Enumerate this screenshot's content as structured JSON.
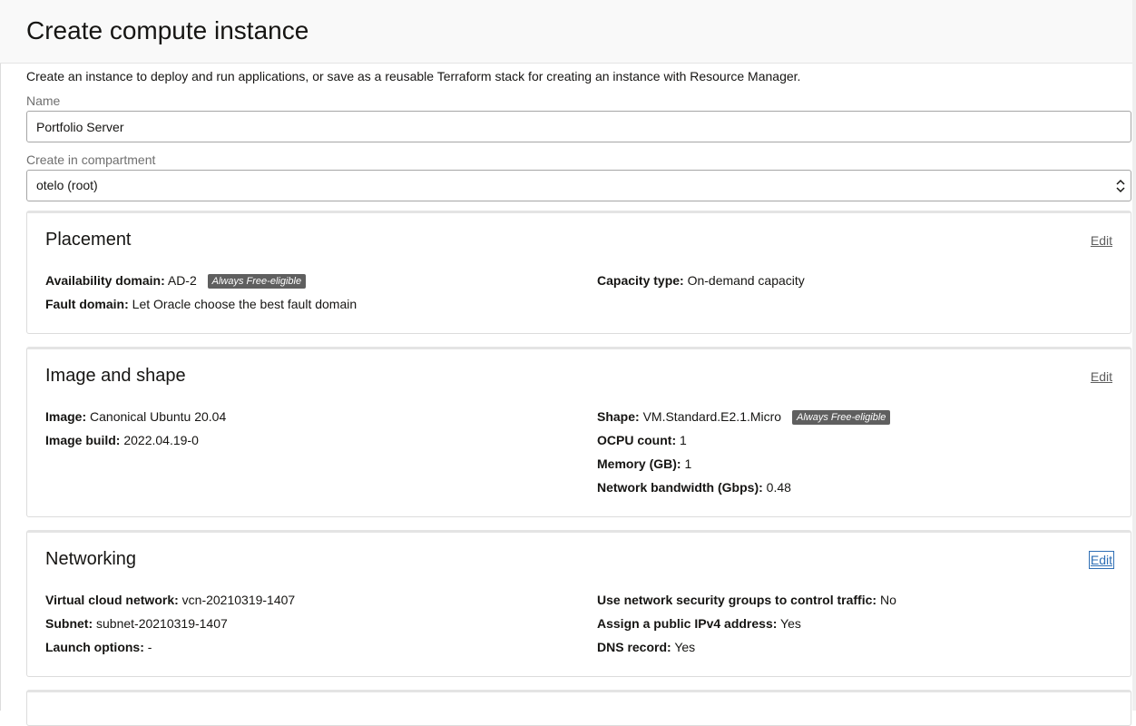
{
  "header": {
    "title": "Create compute instance"
  },
  "intro": {
    "description": "Create an instance to deploy and run applications, or save as a reusable Terraform stack for creating an instance with Resource Manager."
  },
  "name_field": {
    "label": "Name",
    "value": "Portfolio Server"
  },
  "compartment_field": {
    "label": "Create in compartment",
    "value": "otelo (root)"
  },
  "placement": {
    "title": "Placement",
    "edit_label": "Edit",
    "availability_domain_key": "Availability domain:",
    "availability_domain_value": "AD-2",
    "availability_domain_badge": "Always Free-eligible",
    "fault_domain_key": "Fault domain:",
    "fault_domain_value": "Let Oracle choose the best fault domain",
    "capacity_type_key": "Capacity type:",
    "capacity_type_value": "On-demand capacity"
  },
  "image_shape": {
    "title": "Image and shape",
    "edit_label": "Edit",
    "image_key": "Image:",
    "image_value": "Canonical Ubuntu 20.04",
    "image_build_key": "Image build:",
    "image_build_value": "2022.04.19-0",
    "shape_key": "Shape:",
    "shape_value": "VM.Standard.E2.1.Micro",
    "shape_badge": "Always Free-eligible",
    "ocpu_key": "OCPU count:",
    "ocpu_value": "1",
    "memory_key": "Memory (GB):",
    "memory_value": "1",
    "bandwidth_key": "Network bandwidth (Gbps):",
    "bandwidth_value": "0.48"
  },
  "networking": {
    "title": "Networking",
    "edit_label": "Edit",
    "vcn_key": "Virtual cloud network:",
    "vcn_value": "vcn-20210319-1407",
    "subnet_key": "Subnet:",
    "subnet_value": "subnet-20210319-1407",
    "launch_key": "Launch options:",
    "launch_value": "-",
    "nsg_key": "Use network security groups to control traffic:",
    "nsg_value": "No",
    "public_ip_key": "Assign a public IPv4 address:",
    "public_ip_value": "Yes",
    "dns_key": "DNS record:",
    "dns_value": "Yes"
  },
  "colors": {
    "badge_bg": "#5f5f5f",
    "focus_outline": "#2f6fb5",
    "header_bg": "#f9f9f9"
  }
}
